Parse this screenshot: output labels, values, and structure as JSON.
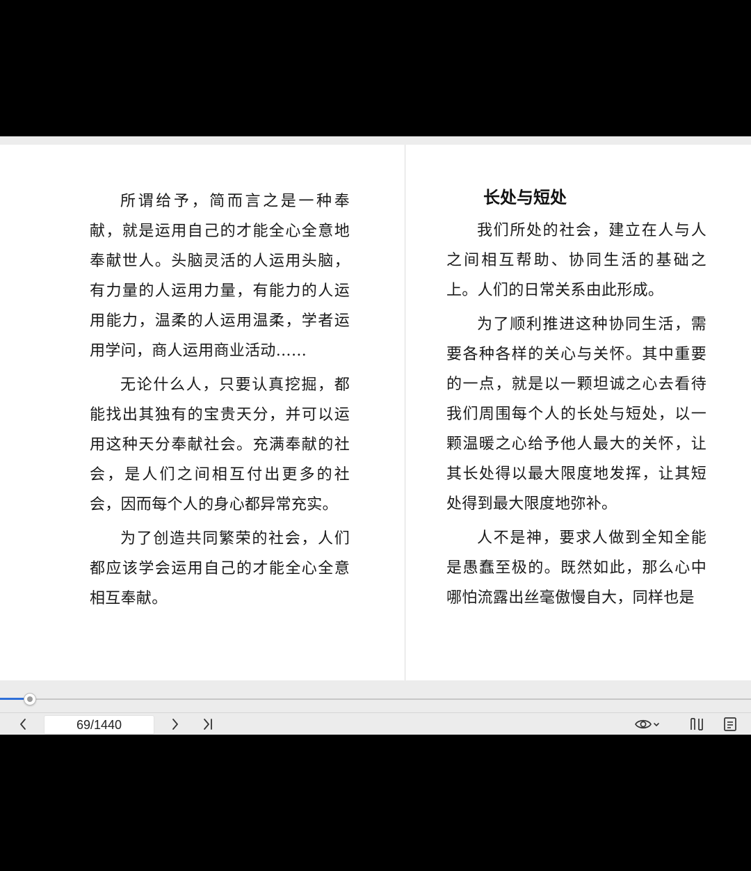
{
  "book": {
    "left_page": {
      "paragraphs": [
        "所谓给予，简而言之是一种奉献，就是运用自己的才能全心全意地奉献世人。头脑灵活的人运用头脑，有力量的人运用力量，有能力的人运用能力，温柔的人运用温柔，学者运用学问，商人运用商业活动……",
        "无论什么人，只要认真挖掘，都能找出其独有的宝贵天分，并可以运用这种天分奉献社会。充满奉献的社会，是人们之间相互付出更多的社会，因而每个人的身心都异常充实。",
        "为了创造共同繁荣的社会，人们都应该学会运用自己的才能全心全意相互奉献。"
      ]
    },
    "right_page": {
      "heading": "长处与短处",
      "paragraphs": [
        "我们所处的社会，建立在人与人之间相互帮助、协同生活的基础之上。人们的日常关系由此形成。",
        "为了顺利推进这种协同生活，需要各种各样的关心与关怀。其中重要的一点，就是以一颗坦诚之心去看待我们周围每个人的长处与短处，以一颗温暖之心给予他人最大的关怀，让其长处得以最大限度地发挥，让其短处得到最大限度地弥补。",
        "人不是神，要求人做到全知全能是愚蠢至极的。既然如此，那么心中哪怕流露出丝毫傲慢自大，同样也是"
      ]
    }
  },
  "progress": {
    "fraction": 0.0392,
    "accent_color": "#2f6fd8"
  },
  "toolbar": {
    "page_indicator": "69/1440",
    "buttons": [
      {
        "name": "prev-page-button",
        "icon": "chevron-left-icon"
      },
      {
        "name": "next-page-button",
        "icon": "chevron-right-icon"
      },
      {
        "name": "last-page-button",
        "icon": "skip-to-end-icon"
      },
      {
        "name": "view-mode-button",
        "icon": "eye-icon"
      },
      {
        "name": "column-layout-button",
        "icon": "two-column-icon"
      },
      {
        "name": "toc-button",
        "icon": "document-list-icon"
      }
    ]
  }
}
